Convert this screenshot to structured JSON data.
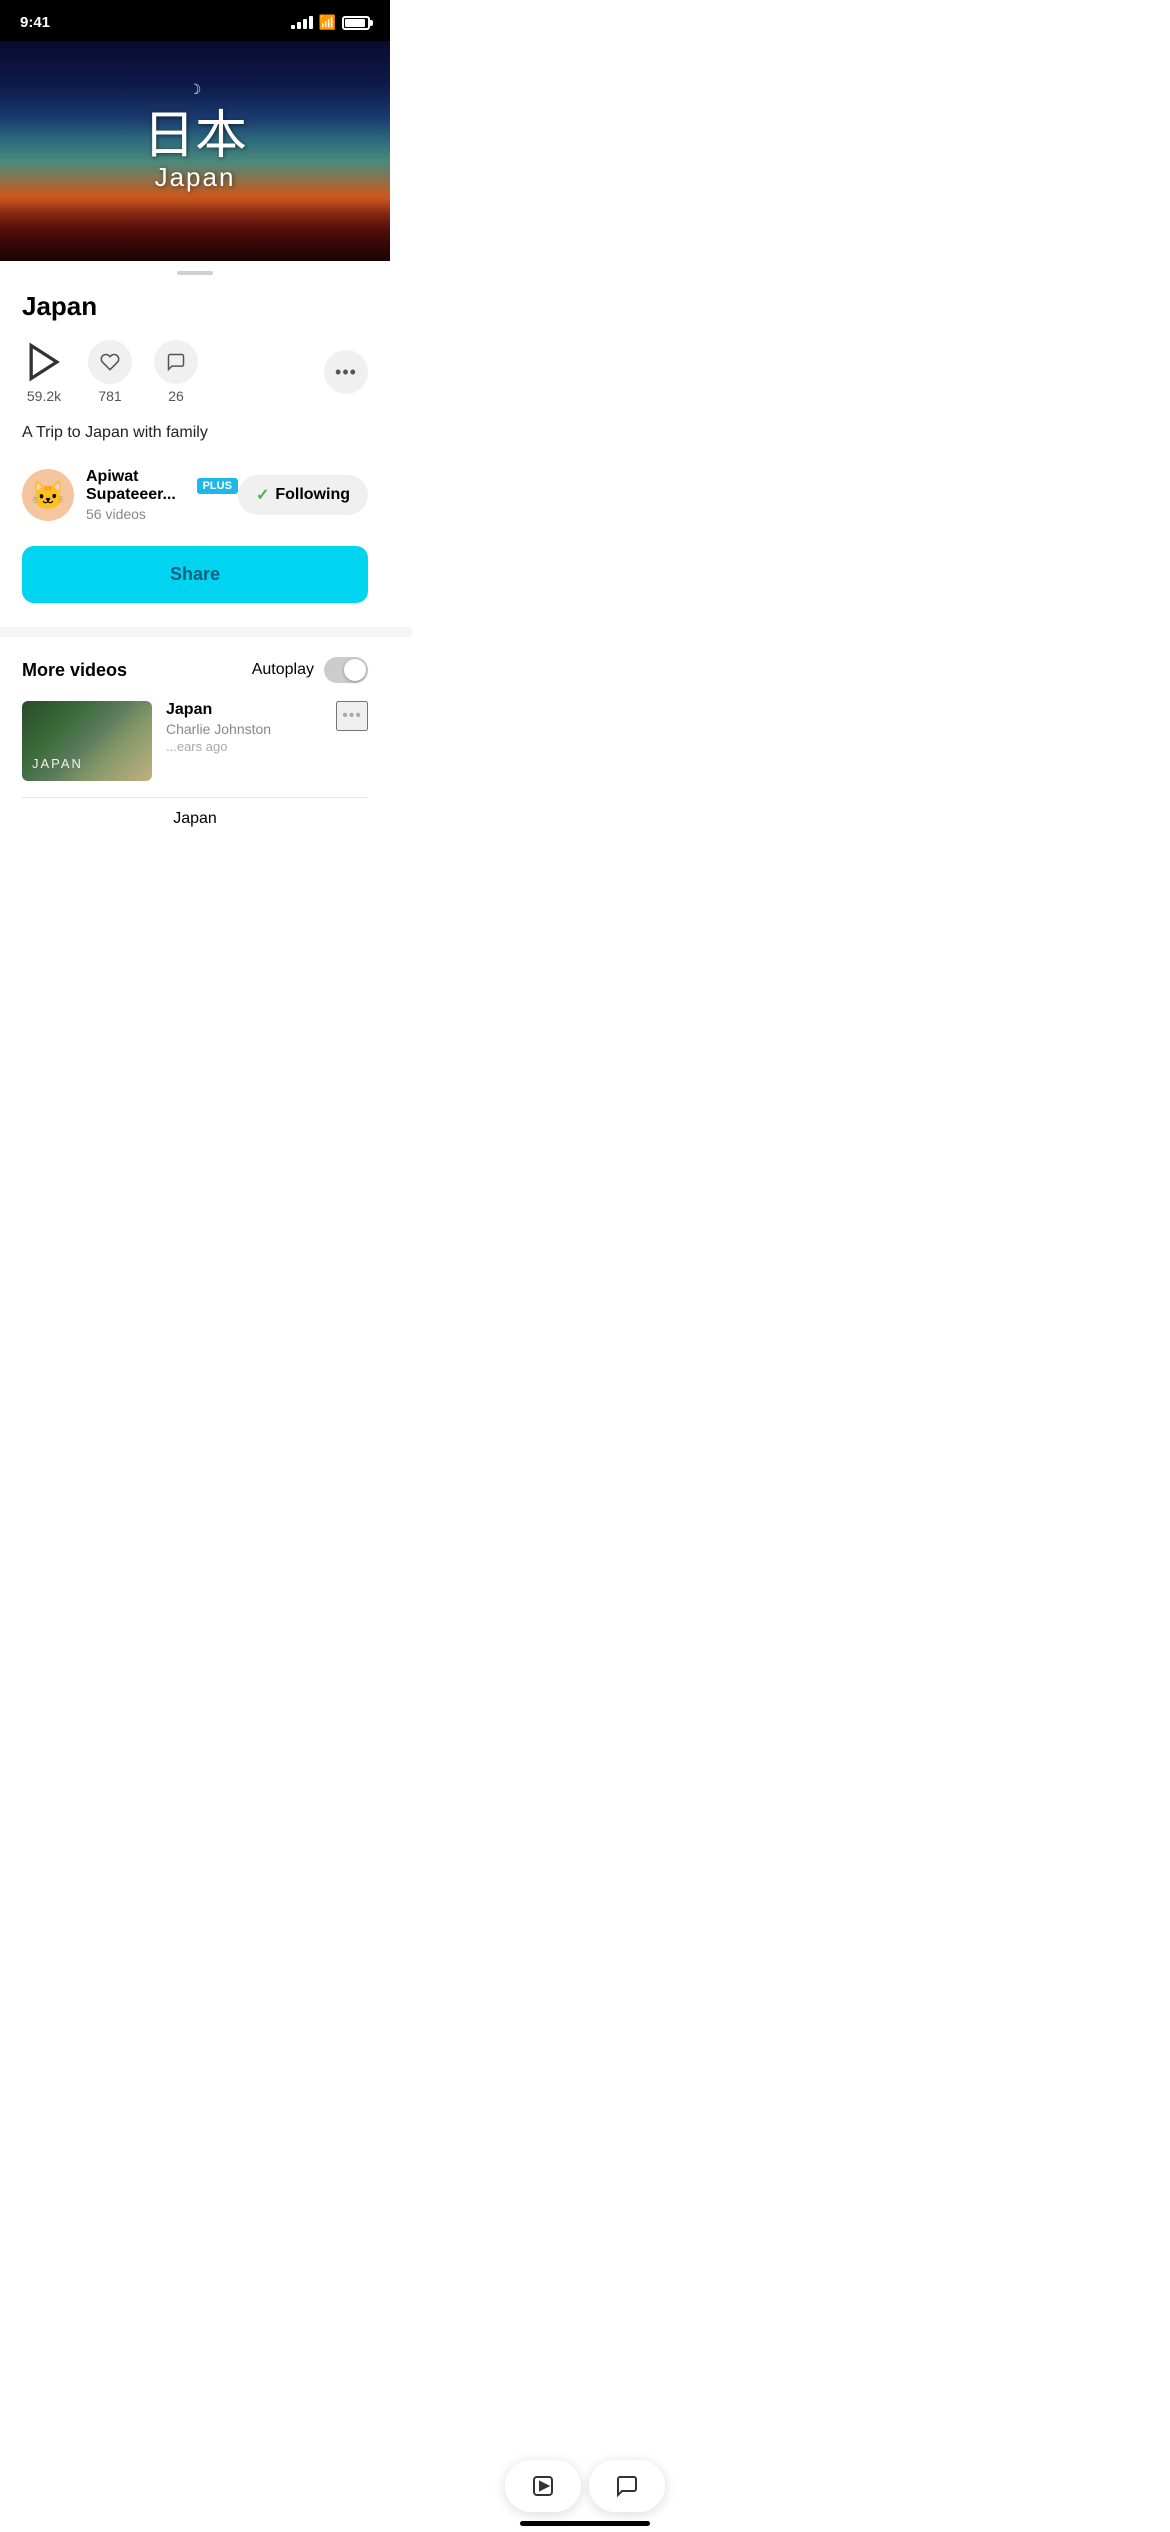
{
  "statusBar": {
    "time": "9:41",
    "signalBars": [
      3,
      5,
      7,
      10,
      12
    ],
    "wifi": "wifi",
    "battery": 90
  },
  "hero": {
    "crescent": "☽",
    "kanji": "日本",
    "subtitle": "Japan"
  },
  "video": {
    "title": "Japan",
    "stats": {
      "plays": "59.2k",
      "likes": "781",
      "comments": "26"
    },
    "description": "A Trip to Japan with family"
  },
  "channel": {
    "name": "Apiwat Supateeer...",
    "badge": "PLUS",
    "videoCount": "56 videos",
    "followLabel": "Following"
  },
  "shareButton": {
    "label": "Share"
  },
  "moreVideos": {
    "title": "More videos",
    "autoplayLabel": "Autoplay",
    "autoplayOn": false,
    "items": [
      {
        "title": "Japan",
        "channel": "Charlie Johnston",
        "meta": "...ears ago",
        "thumbText": "JAPAN"
      }
    ]
  },
  "toolbar": {
    "playLabel": "play",
    "commentLabel": "comment"
  },
  "bottomLabel": "Japan"
}
